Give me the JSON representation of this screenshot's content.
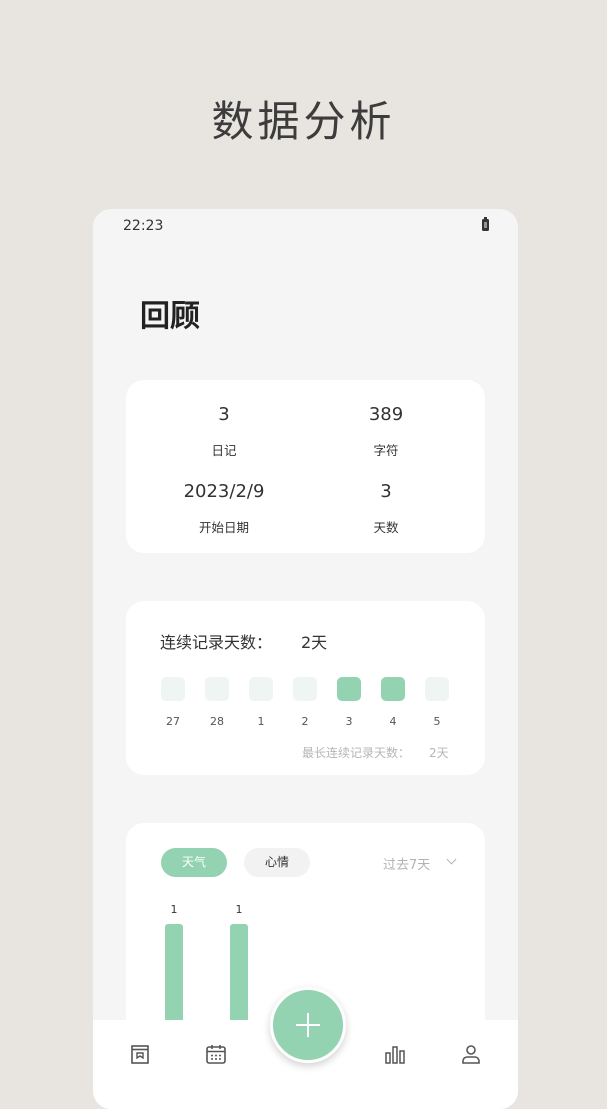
{
  "page_title": "数据分析",
  "status_bar": {
    "time": "22:23",
    "battery_icon": "battery-icon"
  },
  "screen": {
    "heading": "回顾"
  },
  "stats": [
    {
      "value": "3",
      "label": "日记"
    },
    {
      "value": "389",
      "label": "字符"
    },
    {
      "value": "2023/2/9",
      "label": "开始日期"
    },
    {
      "value": "3",
      "label": "天数"
    }
  ],
  "streak": {
    "label": "连续记录天数：",
    "value": "2天",
    "days": [
      {
        "num": "27",
        "active": false
      },
      {
        "num": "28",
        "active": false
      },
      {
        "num": "1",
        "active": false
      },
      {
        "num": "2",
        "active": false
      },
      {
        "num": "3",
        "active": true
      },
      {
        "num": "4",
        "active": true
      },
      {
        "num": "5",
        "active": false
      }
    ],
    "longest_label": "最长连续记录天数：",
    "longest_value": "2天"
  },
  "chart": {
    "tabs": [
      "天气",
      "心情"
    ],
    "active_tab": "天气",
    "range": "过去7天"
  },
  "chart_data": {
    "type": "bar",
    "categories": [
      "",
      ""
    ],
    "values": [
      1,
      1
    ],
    "title": "",
    "xlabel": "",
    "ylabel": ""
  },
  "tabbar": {
    "items": [
      "diary-icon",
      "calendar-icon",
      "add-icon",
      "stats-icon",
      "profile-icon"
    ]
  },
  "colors": {
    "accent": "#94d3b1",
    "background": "#e8e5e1",
    "card": "#ffffff"
  }
}
